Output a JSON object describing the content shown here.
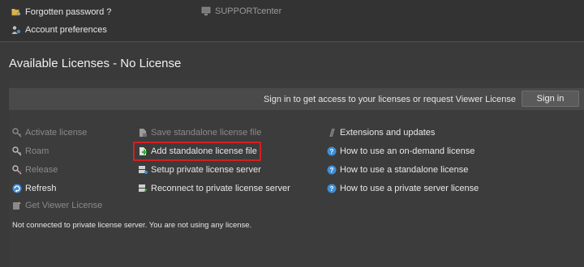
{
  "top_links": {
    "forgotten_password": "Forgotten password ?",
    "support_center": "SUPPORTcenter",
    "account_preferences": "Account preferences"
  },
  "page_title": "Available Licenses - No License",
  "signin": {
    "prompt": "Sign in to get access to your licenses or request Viewer License",
    "button_label": "Sign in"
  },
  "license_actions": {
    "activate": "Activate license",
    "roam": "Roam",
    "release": "Release",
    "refresh": "Refresh",
    "get_viewer": "Get Viewer License"
  },
  "file_actions": {
    "save_standalone": "Save standalone license file",
    "add_standalone": "Add standalone license file",
    "setup_private_server": "Setup private license server",
    "reconnect_private_server": "Reconnect to private license server"
  },
  "help_links": {
    "extensions": "Extensions and updates",
    "on_demand": "How to use an on-demand license",
    "standalone": "How to use a standalone license",
    "private_server": "How to use a private server license"
  },
  "status_text": "Not connected to private license server. You are not using any license.",
  "colors": {
    "background": "#3a3a3a",
    "highlight": "#d42020",
    "help_icon": "#3d8fd8",
    "refresh_icon": "#3d8fd8"
  }
}
